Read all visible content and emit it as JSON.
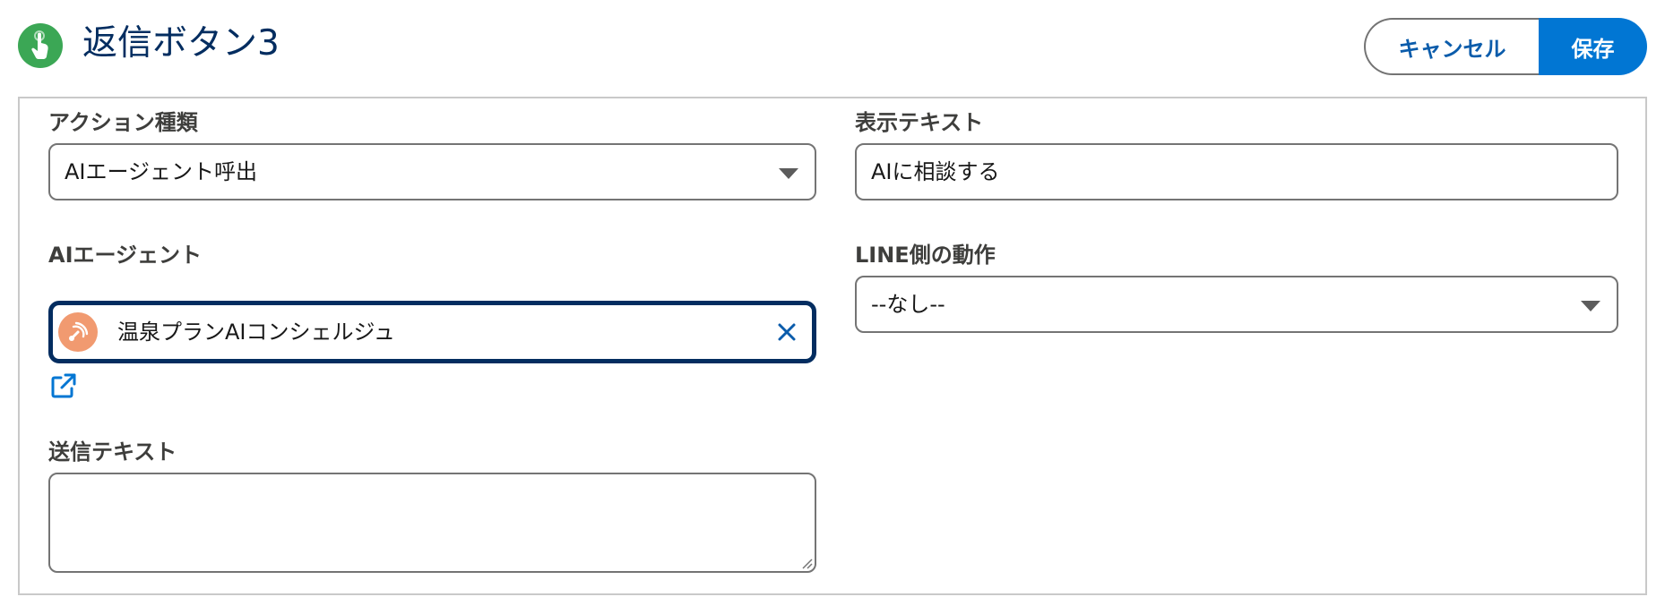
{
  "header": {
    "title": "返信ボタン3",
    "icon": "touch-hand-icon",
    "icon_color": "#3ba755",
    "cancel_label": "キャンセル",
    "save_label": "保存"
  },
  "form": {
    "action_type": {
      "label": "アクション種類",
      "value": "AIエージェント呼出"
    },
    "display_text": {
      "label": "表示テキスト",
      "value": "AIに相談する"
    },
    "ai_agent": {
      "label": "AIエージェント",
      "value": "温泉プランAIコンシェルジュ",
      "icon": "agent-avatar-icon",
      "icon_color": "#f19a70"
    },
    "line_action": {
      "label": "LINE側の動作",
      "value": "--なし--"
    },
    "send_text": {
      "label": "送信テキスト",
      "value": ""
    }
  },
  "colors": {
    "accent": "#0176d3",
    "title": "#032d60",
    "link": "#0b5cab"
  }
}
